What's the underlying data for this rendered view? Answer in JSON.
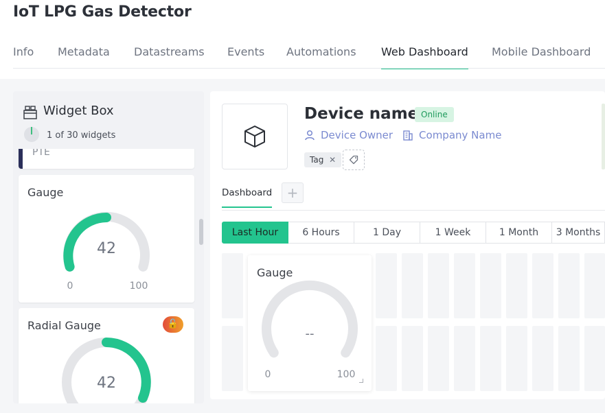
{
  "app": {
    "title": "IoT LPG Gas Detector"
  },
  "tabs": [
    {
      "label": "Info"
    },
    {
      "label": "Metadata"
    },
    {
      "label": "Datastreams"
    },
    {
      "label": "Events"
    },
    {
      "label": "Automations"
    },
    {
      "label": "Web Dashboard",
      "active": true
    },
    {
      "label": "Mobile Dashboard"
    }
  ],
  "widget_box": {
    "title": "Widget Box",
    "count": "1 of 30 widgets",
    "partial_card_text": "PTE",
    "widgets": [
      {
        "label": "Gauge",
        "value": "42",
        "min": "0",
        "max": "100",
        "fill_fraction": 0.42
      },
      {
        "label": "Radial Gauge",
        "value": "42",
        "badge": "🔓"
      }
    ]
  },
  "device": {
    "name": "Device name",
    "status": "Online",
    "owner": "Device Owner",
    "company": "Company Name",
    "tag": "Tag"
  },
  "dashboard": {
    "tab_label": "Dashboard",
    "add_label": "+",
    "time_ranges": [
      {
        "label": "Last Hour",
        "active": true
      },
      {
        "label": "6 Hours"
      },
      {
        "label": "1 Day"
      },
      {
        "label": "1 Week"
      },
      {
        "label": "1 Month"
      },
      {
        "label": "3 Months"
      }
    ],
    "gauge_widget": {
      "label": "Gauge",
      "value": "--",
      "min": "0",
      "max": "100"
    }
  },
  "colors": {
    "accent": "#23c48e",
    "online_bg": "#d7f4e3",
    "link": "#7a8ad0"
  }
}
